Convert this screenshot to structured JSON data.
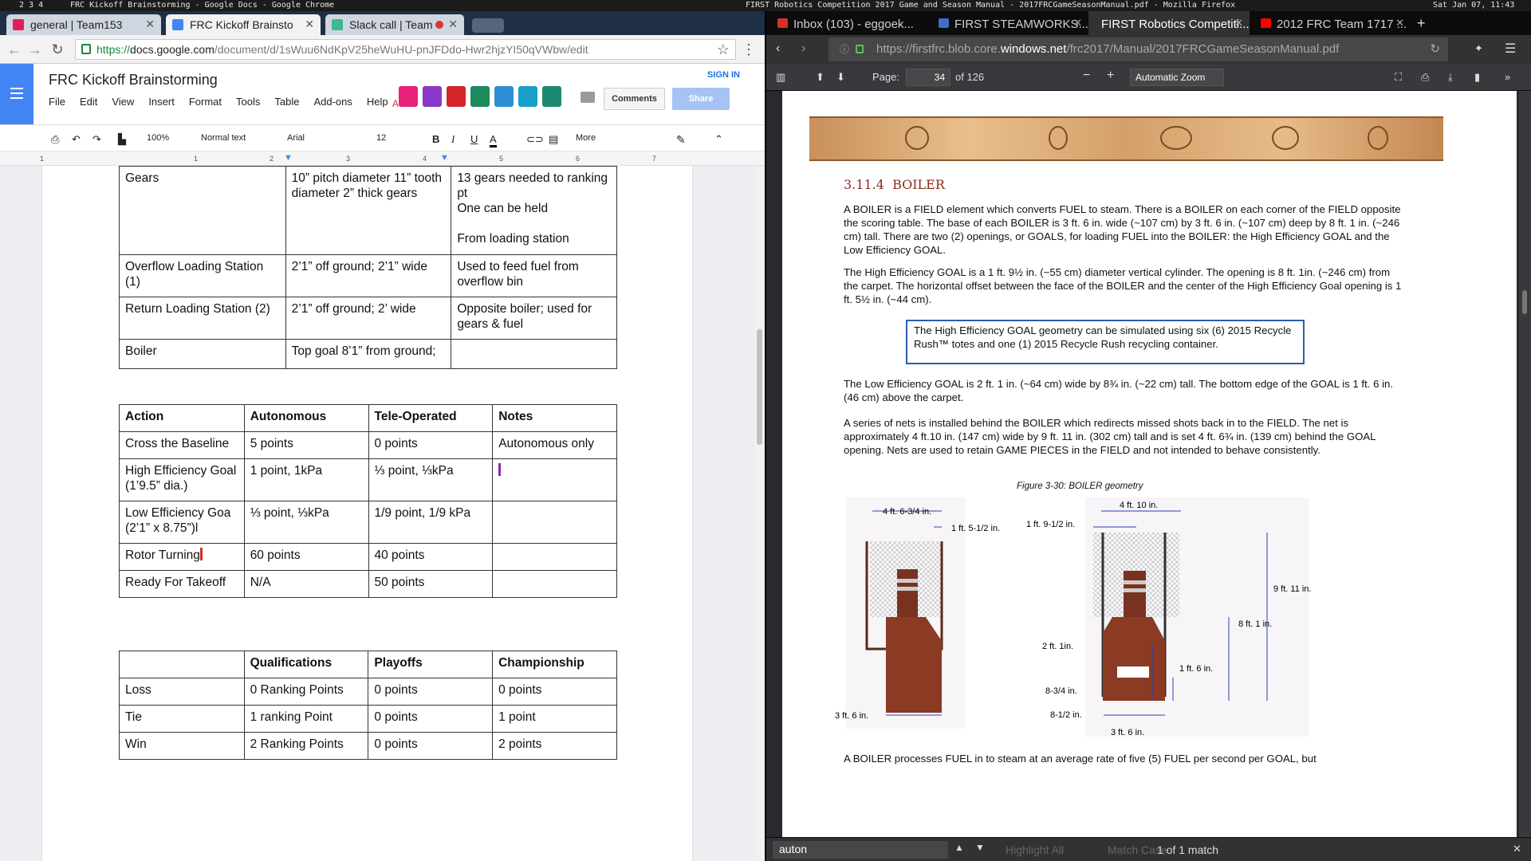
{
  "topbar": {
    "workspaces": "2 3 4",
    "left_title": "FRC Kickoff Brainstorming - Google Docs - Google Chrome",
    "right_title": "FIRST Robotics Competition 2017 Game and Season Manual - 2017FRCGameSeasonManual.pdf - Mozilla Firefox",
    "clock": "Sat Jan 07, 11:43"
  },
  "chrome": {
    "tabs": [
      {
        "label": "general | Team153"
      },
      {
        "label": "FRC Kickoff Brainsto"
      },
      {
        "label": "Slack call | Team"
      }
    ],
    "url_scheme": "https://",
    "url_host": "docs.google.com",
    "url_path": "/document/d/1sWuu6NdKpV25heWuHU-pnJFDdo-Hwr2hjzYI50qVWbw/edit"
  },
  "docs": {
    "title": "FRC Kickoff Brainstorming",
    "menu": [
      "File",
      "Edit",
      "View",
      "Insert",
      "Format",
      "Tools",
      "Table",
      "Add-ons",
      "Help"
    ],
    "addons_label": "A",
    "sign_in": "SIGN IN",
    "comments": "Comments",
    "share": "Share",
    "toolbar": {
      "zoom": "100%",
      "style": "Normal text",
      "font": "Arial",
      "size": "12",
      "more": "More"
    },
    "ruler": [
      "1",
      "1",
      "2",
      "3",
      "4",
      "5",
      "6",
      "7"
    ],
    "table1": [
      [
        "Gears",
        "10” pitch diameter 11” tooth diameter 2” thick gears",
        "13 gears needed to ranking pt\nOne can be held\n\nFrom loading station"
      ],
      [
        "Overflow Loading Station (1)",
        "2’1” off ground; 2’1” wide",
        "Used to feed fuel from overflow bin"
      ],
      [
        "Return Loading Station (2)",
        "2’1” off ground; 2’ wide",
        "Opposite boiler; used for gears & fuel"
      ],
      [
        "Boiler",
        "Top goal 8’1” from ground;",
        ""
      ]
    ],
    "table2_header": [
      "Action",
      "Autonomous",
      "Tele-Operated",
      "Notes"
    ],
    "table2": [
      [
        "Cross the Baseline",
        "5 points",
        "0 points",
        "Autonomous only"
      ],
      [
        "High Efficiency Goal (1’9.5” dia.)",
        "1 point, 1kPa",
        "⅓ point, ⅓kPa",
        ""
      ],
      [
        "Low Efficiency Goa (2’1” x 8.75”)l",
        "⅓ point, ⅓kPa",
        "1/9 point, 1/9 kPa",
        ""
      ],
      [
        "Rotor Turning",
        "60 points",
        "40 points",
        ""
      ],
      [
        "Ready For Takeoff",
        "N/A",
        "50 points",
        ""
      ]
    ],
    "table3_header": [
      "",
      "Qualifications",
      "Playoffs",
      "Championship"
    ],
    "table3": [
      [
        "Loss",
        "0 Ranking Points",
        "0 points",
        "0 points"
      ],
      [
        "Tie",
        "1 ranking Point",
        "0 points",
        "1 point"
      ],
      [
        "Win",
        "2 Ranking Points",
        "0 points",
        "2 points"
      ]
    ]
  },
  "firefox": {
    "tabs": [
      {
        "label": "Inbox (103) - eggoek..."
      },
      {
        "label": "FIRST STEAMWORKS..."
      },
      {
        "label": "FIRST Robotics Competiti..."
      },
      {
        "label": "2012 FRC Team 1717 ..."
      }
    ],
    "url_prefix": "https://firstfrc.blob.core.",
    "url_host": "windows.net",
    "url_path": "/frc2017/Manual/2017FRCGameSeasonManual.pdf",
    "page_label": "Page:",
    "page_number": "34",
    "page_count": "of 126",
    "zoom": "Automatic Zoom",
    "find_query": "auton",
    "find_highlight": "Highlight All",
    "find_matchcase": "Match Case",
    "find_result": "1 of 1 match"
  },
  "pdf": {
    "section_number": "3.11.4",
    "section_title": "BOILER",
    "p1": "A BOILER is a FIELD element which converts FUEL to steam. There is a BOILER on each corner of the FIELD opposite the scoring table. The base of each BOILER is 3 ft. 6 in. wide (~107 cm) by 3 ft. 6 in. (~107 cm) deep by 8 ft. 1 in. (~246 cm) tall. There are two (2) openings, or GOALS, for loading FUEL into the BOILER: the High Efficiency GOAL and the Low Efficiency GOAL.",
    "p2": "The High Efficiency GOAL is a 1 ft. 9½ in. (~55 cm) diameter vertical cylinder. The opening is 8 ft. 1in. (~246 cm) from the carpet. The horizontal offset between the face of the BOILER and the center of the High Efficiency Goal opening is 1 ft. 5½ in. (~44 cm).",
    "callout": "The High Efficiency GOAL geometry can be simulated using six (6) 2015 Recycle Rush™ totes and one (1) 2015 Recycle Rush recycling container.",
    "p3": "The Low Efficiency GOAL is 2 ft. 1 in. (~64 cm) wide by 8¾ in. (~22 cm) tall. The bottom edge of the GOAL is 1 ft. 6 in. (46 cm) above the carpet.",
    "p4": "A series of nets is installed behind the BOILER which redirects missed shots back in to the FIELD. The net is approximately 4 ft.10 in. (147 cm) wide by 9 ft. 11 in. (302 cm) tall and is set 4 ft. 6¾ in. (139 cm) behind the GOAL opening. Nets are used to retain GAME PIECES in the FIELD and not intended to behave consistently.",
    "figure_caption": "Figure 3-30: BOILER geometry",
    "dims_left": [
      "4 ft. 6-3/4 in.",
      "1 ft. 5-1/2 in.",
      "3 ft. 6 in."
    ],
    "dims_right": [
      "4 ft. 10 in.",
      "1 ft. 9-1/2 in.",
      "9 ft. 11 in.",
      "8 ft. 1 in.",
      "2 ft. 1in.",
      "1 ft. 6 in.",
      "8-3/4 in.",
      "8-1/2 in.",
      "3 ft. 6 in."
    ],
    "p5": "A BOILER processes FUEL in to steam at an average rate of five (5) FUEL per second per GOAL, but"
  },
  "colors": {
    "docs_blue": "#4285f4",
    "boiler_brown": "#8b3a24",
    "callout_border": "#2a5db0"
  }
}
